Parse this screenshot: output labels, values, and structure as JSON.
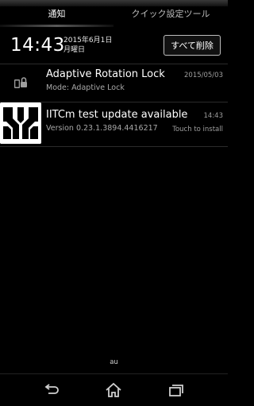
{
  "tabs": {
    "notifications": "通知",
    "quick_settings": "クイック設定ツール"
  },
  "header": {
    "time": "14:43",
    "date_line1": "2015年6月1日",
    "date_line2": "月曜日",
    "clear_all": "すべて削除"
  },
  "notifications": [
    {
      "icon": "rotation-lock-icon",
      "title": "Adaptive Rotation Lock",
      "subtitle": "Mode: Adaptive Lock",
      "time": "2015/05/03"
    },
    {
      "icon": "app-icon",
      "title": "IITCm test update available",
      "subtitle": "Version 0.23.1.3894.4416217",
      "time": "14:43",
      "info": "Touch to install"
    }
  ],
  "carrier": "au",
  "navbar": {
    "icons": [
      "back-icon",
      "home-icon",
      "recent-apps-icon"
    ]
  }
}
